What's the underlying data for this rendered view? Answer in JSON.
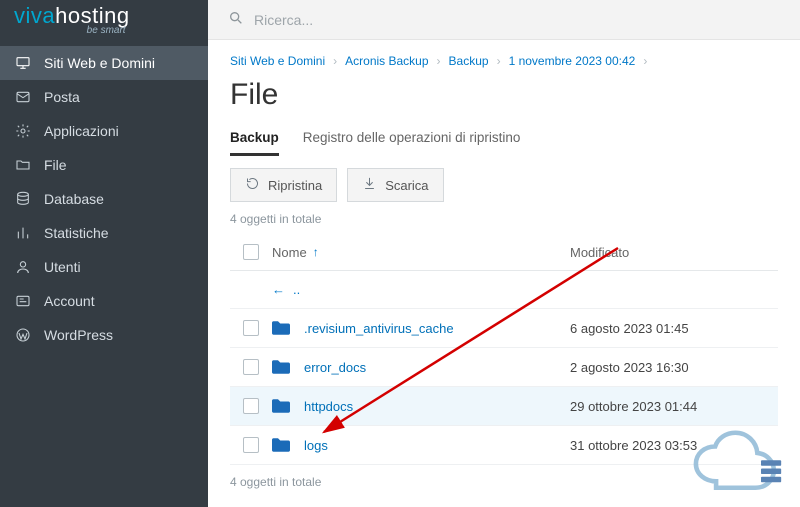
{
  "brand": {
    "pre": "viva",
    "post": "hosting",
    "tag": "be smart"
  },
  "search": {
    "placeholder": "Ricerca..."
  },
  "sidebar": {
    "items": [
      {
        "label": "Siti Web e Domini"
      },
      {
        "label": "Posta"
      },
      {
        "label": "Applicazioni"
      },
      {
        "label": "File"
      },
      {
        "label": "Database"
      },
      {
        "label": "Statistiche"
      },
      {
        "label": "Utenti"
      },
      {
        "label": "Account"
      },
      {
        "label": "WordPress"
      }
    ]
  },
  "breadcrumb": {
    "items": [
      "Siti Web e Domini",
      "Acronis Backup",
      "Backup",
      "1 novembre 2023 00:42"
    ]
  },
  "page": {
    "title": "File"
  },
  "tabs": {
    "backup": "Backup",
    "log": "Registro delle operazioni di ripristino"
  },
  "toolbar": {
    "restore": "Ripristina",
    "download": "Scarica"
  },
  "table": {
    "count_text": "4 oggetti in totale",
    "header_name": "Nome",
    "header_modified": "Modificato",
    "up_label": "..",
    "rows": [
      {
        "name": ".revisium_antivirus_cache",
        "modified": "6 agosto 2023 01:45"
      },
      {
        "name": "error_docs",
        "modified": "2 agosto 2023 16:30"
      },
      {
        "name": "httpdocs",
        "modified": "29 ottobre 2023 01:44",
        "highlight": true
      },
      {
        "name": "logs",
        "modified": "31 ottobre 2023 03:53"
      }
    ]
  }
}
